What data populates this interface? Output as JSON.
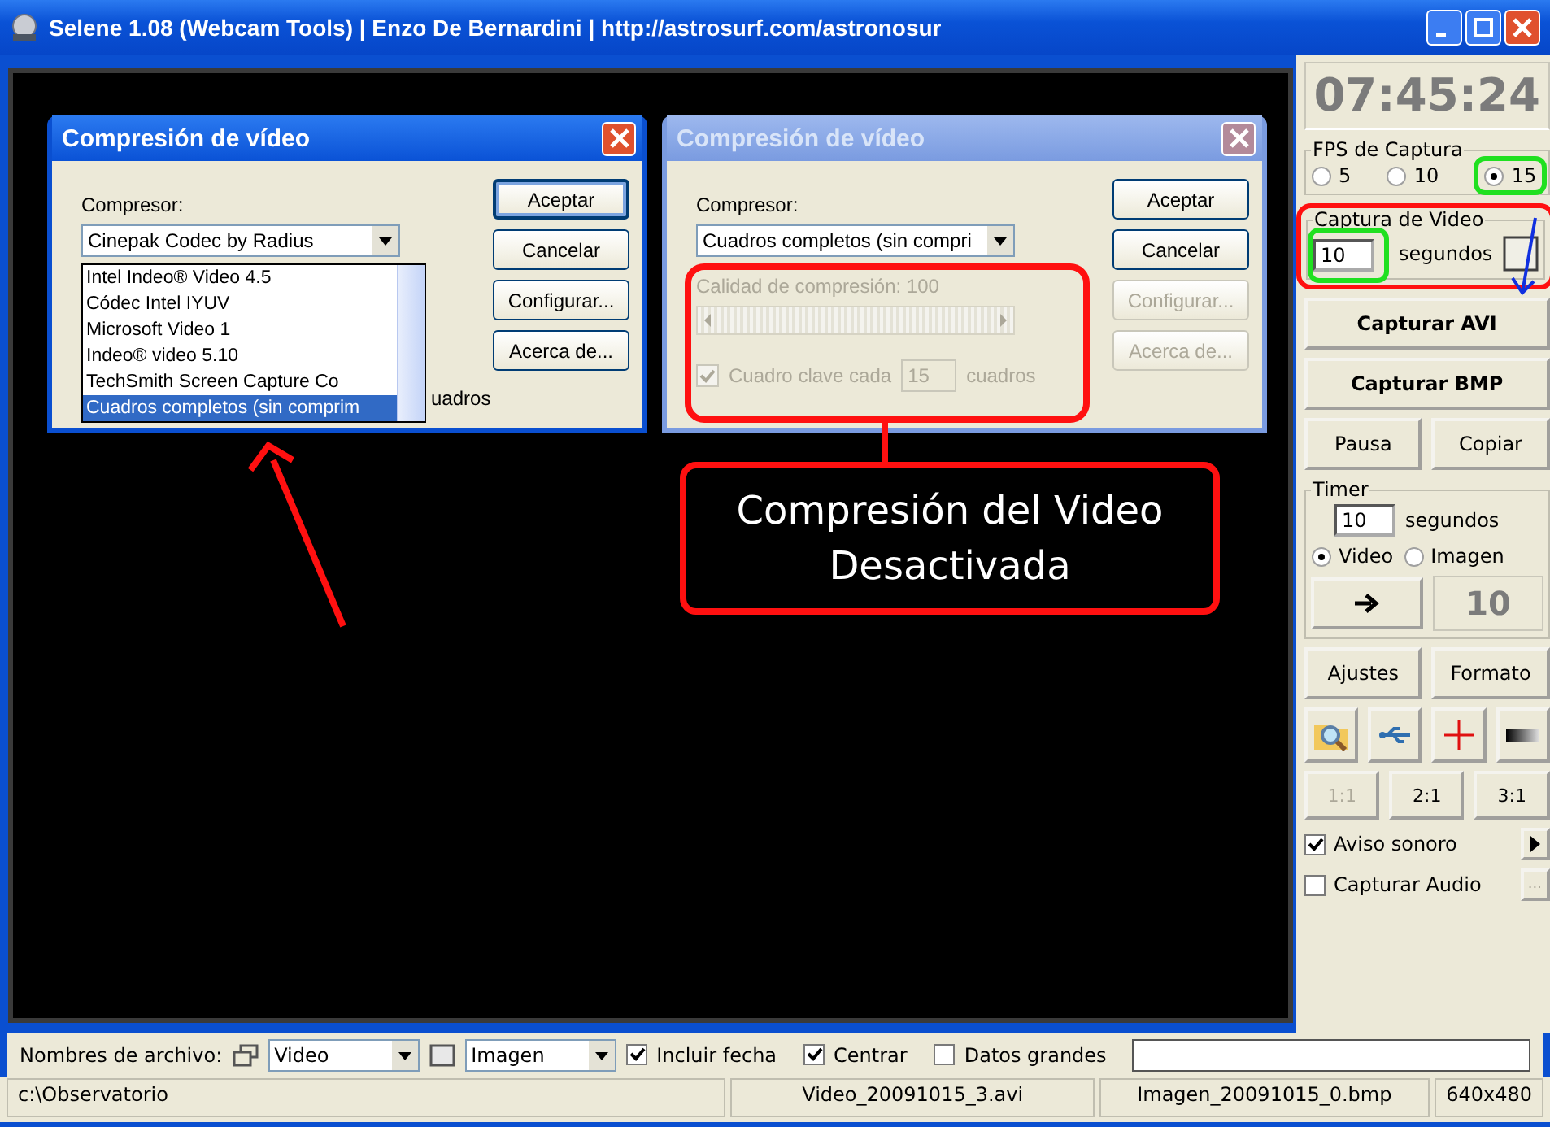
{
  "window": {
    "title": "Selene 1.08 (Webcam Tools) | Enzo De Bernardini | http://astrosurf.com/astronosur"
  },
  "dialogs": [
    {
      "title": "Compresión de vídeo",
      "active": true,
      "compressor_label": "Compresor:",
      "compressor_value": "Cinepak Codec by Radius",
      "dropdown_open": true,
      "hidden_label": "uadros",
      "options": [
        {
          "label": "Intel Indeo® Video 4.5",
          "selected": false
        },
        {
          "label": "Códec Intel IYUV",
          "selected": false
        },
        {
          "label": "Microsoft Video 1",
          "selected": false
        },
        {
          "label": "Indeo® video 5.10",
          "selected": false
        },
        {
          "label": "TechSmith Screen Capture Co",
          "selected": false
        },
        {
          "label": "Cuadros completos (sin comprim",
          "selected": true
        }
      ],
      "buttons": [
        {
          "label": "Aceptar",
          "disabled": false
        },
        {
          "label": "Cancelar",
          "disabled": false
        },
        {
          "label": "Configurar...",
          "disabled": false
        },
        {
          "label": "Acerca de...",
          "disabled": false
        }
      ]
    },
    {
      "title": "Compresión de vídeo",
      "active": false,
      "compressor_label": "Compresor:",
      "compressor_value": "Cuadros completos (sin compri",
      "dropdown_open": false,
      "quality_label": "Calidad de compresión: 100",
      "slider_enabled": false,
      "keyframe": {
        "checked": true,
        "label": "Cuadro clave cada",
        "value": "15",
        "unit": "cuadros"
      },
      "buttons": [
        {
          "label": "Aceptar",
          "disabled": false
        },
        {
          "label": "Cancelar",
          "disabled": false
        },
        {
          "label": "Configurar...",
          "disabled": true
        },
        {
          "label": "Acerca de...",
          "disabled": true
        }
      ]
    }
  ],
  "callout": {
    "lines": [
      "Compresión del Video",
      "Desactivada"
    ]
  },
  "clock": "07:45:24",
  "fps": {
    "label": "FPS de Captura",
    "options": [
      {
        "label": "5",
        "selected": false
      },
      {
        "label": "10",
        "selected": false
      },
      {
        "label": "15",
        "selected": true
      }
    ]
  },
  "video_capture": {
    "label": "Captura de Video",
    "value": "10",
    "unit": "segundos",
    "checked": false
  },
  "capture_buttons": [
    "Capturar AVI",
    "Capturar BMP"
  ],
  "pair_buttons": [
    "Pausa",
    "Copiar"
  ],
  "timer": {
    "label": "Timer",
    "value": "10",
    "unit": "segundos",
    "modes": [
      {
        "label": "Video",
        "selected": true
      },
      {
        "label": "Imagen",
        "selected": false
      }
    ],
    "count": "10"
  },
  "settings_buttons": [
    "Ajustes",
    "Formato"
  ],
  "zoom_buttons": [
    {
      "label": "1:1",
      "disabled": true
    },
    {
      "label": "2:1",
      "disabled": false
    },
    {
      "label": "3:1",
      "disabled": false
    }
  ],
  "sound": {
    "label": "Aviso sonoro",
    "checked": true
  },
  "audio": {
    "label": "Capturar Audio",
    "checked": false,
    "button": "..."
  },
  "file_names": {
    "label": "Nombres de archivo:",
    "video": "Video",
    "image": "Imagen",
    "options": [
      {
        "label": "Incluir fecha",
        "checked": true
      },
      {
        "label": "Centrar",
        "checked": true
      },
      {
        "label": "Datos grandes",
        "checked": false
      }
    ]
  },
  "status_bar": [
    "c:\\Observatorio",
    "Video_20091015_3.avi",
    "Imagen_20091015_0.bmp",
    "640x480"
  ]
}
